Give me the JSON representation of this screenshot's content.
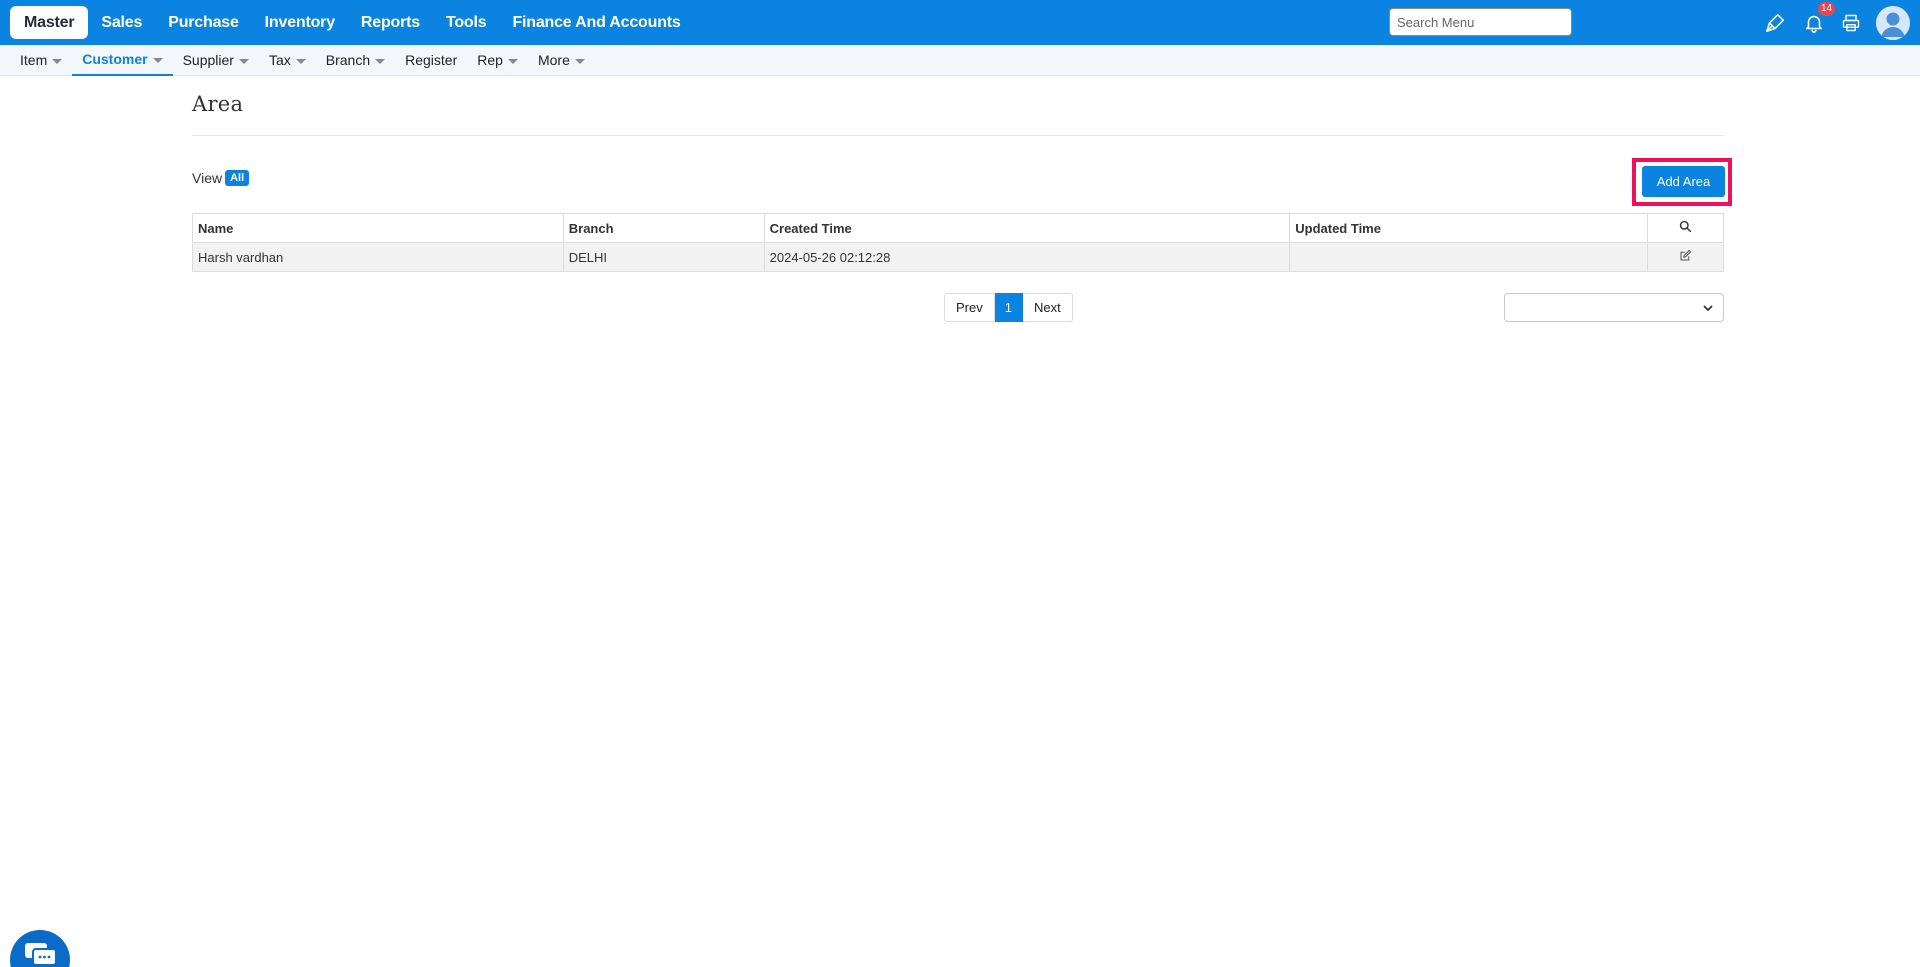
{
  "topnav": {
    "items": [
      {
        "label": "Master",
        "active": true
      },
      {
        "label": "Sales",
        "active": false
      },
      {
        "label": "Purchase",
        "active": false
      },
      {
        "label": "Inventory",
        "active": false
      },
      {
        "label": "Reports",
        "active": false
      },
      {
        "label": "Tools",
        "active": false
      },
      {
        "label": "Finance And Accounts",
        "active": false
      }
    ],
    "search_placeholder": "Search Menu",
    "icons": [
      "pen-icon",
      "bell-icon",
      "printer-icon",
      "user-avatar-icon"
    ],
    "notification_count": "14"
  },
  "subnav": {
    "items": [
      {
        "label": "Item",
        "caret": true,
        "active": false
      },
      {
        "label": "Customer",
        "caret": true,
        "active": true
      },
      {
        "label": "Supplier",
        "caret": true,
        "active": false
      },
      {
        "label": "Tax",
        "caret": true,
        "active": false
      },
      {
        "label": "Branch",
        "caret": true,
        "active": false
      },
      {
        "label": "Register",
        "caret": false,
        "active": false
      },
      {
        "label": "Rep",
        "caret": true,
        "active": false
      },
      {
        "label": "More",
        "caret": true,
        "active": false
      }
    ]
  },
  "page": {
    "title": "Area",
    "view_label": "View",
    "view_filter": "All",
    "add_button": "Add Area"
  },
  "table": {
    "headers": [
      "Name",
      "Branch",
      "Created Time",
      "Updated Time"
    ],
    "rows": [
      {
        "name": "Harsh vardhan",
        "branch": "DELHI",
        "created": "2024-05-26 02:12:28",
        "updated": ""
      }
    ]
  },
  "pagination": {
    "prev": "Prev",
    "current": "1",
    "next": "Next"
  },
  "page_size_select": {
    "value": ""
  },
  "colors": {
    "primary": "#0a84e0",
    "highlight": "#ef0f5c",
    "badge": "#e8464f"
  }
}
